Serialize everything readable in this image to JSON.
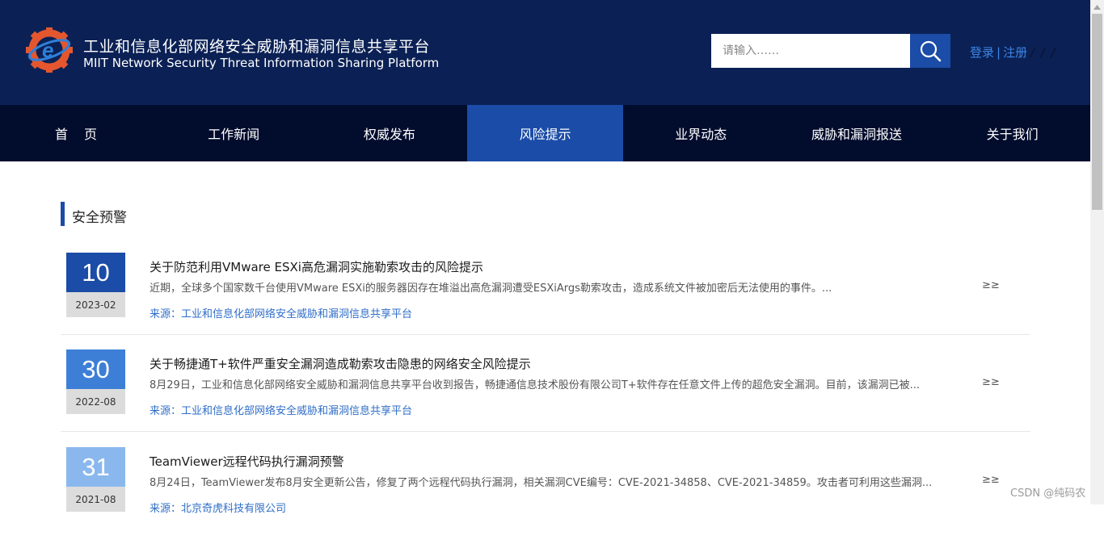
{
  "header": {
    "title_cn": "工业和信息化部网络安全威胁和漏洞信息共享平台",
    "title_en": "MIIT Network Security Threat Information Sharing Platform",
    "logo_icon": "logo-gear-e-icon",
    "search": {
      "placeholder": "请输入……",
      "value": ""
    },
    "search_icon": "search-icon",
    "login_label": "登录",
    "auth_separator": "|",
    "register_label": "注册",
    "slashes": "/ / /",
    "colors": {
      "background": "#0b2155",
      "accent": "#1b4ca7",
      "link": "#3d86e6"
    }
  },
  "nav": {
    "items": [
      {
        "label": "首页"
      },
      {
        "label": "工作新闻"
      },
      {
        "label": "权威发布"
      },
      {
        "label": "风险提示",
        "active": true
      },
      {
        "label": "业界动态"
      },
      {
        "label": "威胁和漏洞报送"
      },
      {
        "label": "关于我们"
      }
    ],
    "colors": {
      "background": "#020c2d",
      "active": "#1b4ca7"
    }
  },
  "section": {
    "title": "安全预警"
  },
  "news": [
    {
      "day": "10",
      "year_month": "2023-02",
      "day_color": "#1b4ca7",
      "title": "关于防范利用VMware ESXi高危漏洞实施勒索攻击的风险提示",
      "summary": "近期，全球多个国家数千台使用VMware ESXi的服务器因存在堆溢出高危漏洞遭受ESXiArgs勒索攻击，造成系统文件被加密后无法使用的事件。...",
      "more": "≥≥",
      "source": "来源：工业和信息化部网络安全威胁和漏洞信息共享平台"
    },
    {
      "day": "30",
      "year_month": "2022-08",
      "day_color": "#3d7fd6",
      "title": "关于畅捷通T+软件严重安全漏洞造成勒索攻击隐患的网络安全风险提示",
      "summary": "8月29日，工业和信息化部网络安全威胁和漏洞信息共享平台收到报告，畅捷通信息技术股份有限公司T+软件存在任意文件上传的超危安全漏洞。目前，该漏洞已被...",
      "more": "≥≥",
      "source": "来源：工业和信息化部网络安全威胁和漏洞信息共享平台"
    },
    {
      "day": "31",
      "year_month": "2021-08",
      "day_color": "#8ab8ee",
      "title": "TeamViewer远程代码执行漏洞预警",
      "summary": "8月24日，TeamViewer发布8月安全更新公告，修复了两个远程代码执行漏洞，相关漏洞CVE编号：CVE-2021-34858、CVE-2021-34859。攻击者可利用这些漏洞...",
      "more": "≥≥",
      "source": "来源：北京奇虎科技有限公司"
    }
  ],
  "watermark": "CSDN @纯码农"
}
